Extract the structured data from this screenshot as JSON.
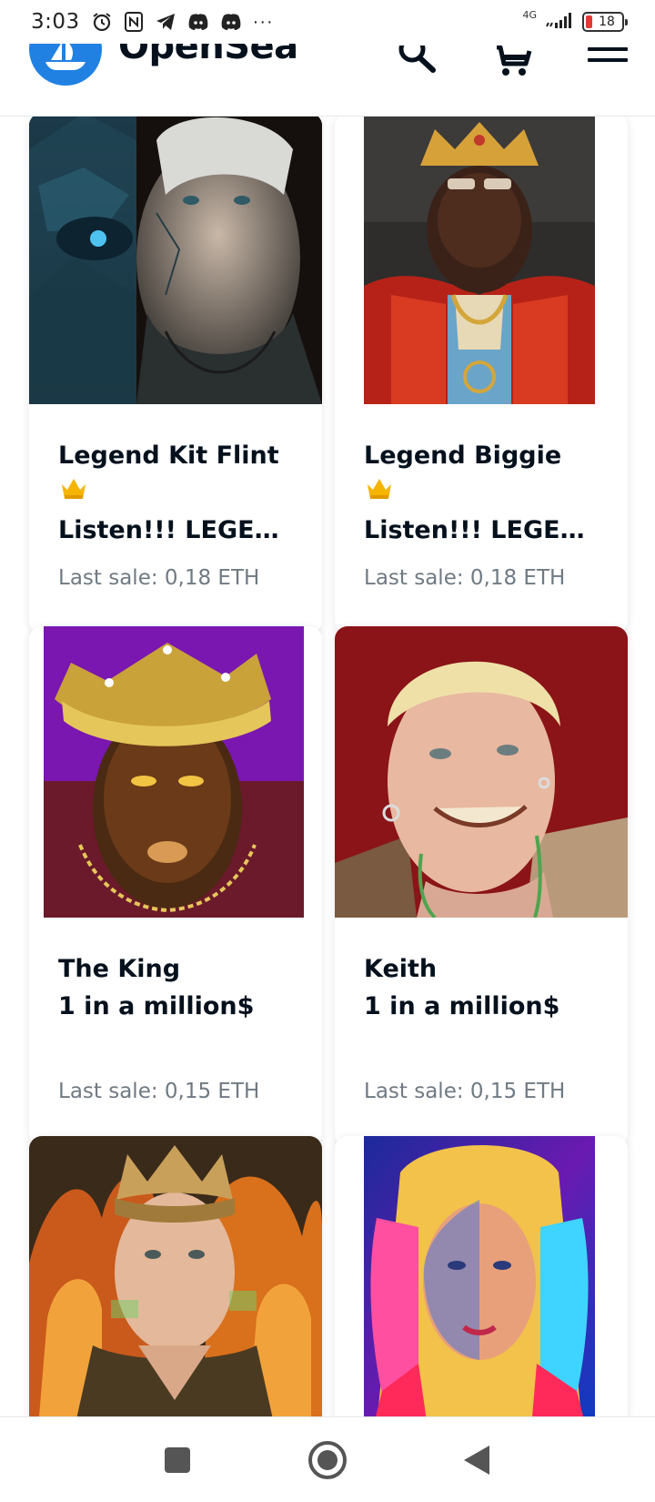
{
  "status_bar": {
    "time": "3:03",
    "network": "4G",
    "battery": "18",
    "more": "···",
    "icons": [
      "alarm-icon",
      "nfc-icon",
      "telegram-icon",
      "discord-icon",
      "discord-icon",
      "signal-icon",
      "battery-icon"
    ]
  },
  "header": {
    "logo_text": "OpenSea",
    "icons": [
      "opensea-logo-icon",
      "search-icon",
      "cart-icon",
      "menu-icon"
    ]
  },
  "cards": [
    {
      "title_line1": "Legend Kit Flint",
      "title_line2": "Listen!!! LEGE…",
      "title_emoji": "crown-icon",
      "sale_label": "Last sale:",
      "sale_price": "0,18 ETH"
    },
    {
      "title_line1": "Legend Biggie",
      "title_line2": "Listen!!! LEGE…",
      "title_emoji": "crown-icon",
      "sale_label": "Last sale:",
      "sale_price": "0,18 ETH"
    },
    {
      "title_line1": "The King",
      "title_line2": "1 in a million$",
      "sale_label": "Last sale:",
      "sale_price": "0,15 ETH"
    },
    {
      "title_line1": "Keith",
      "title_line2": "1 in a million$",
      "sale_label": "Last sale:",
      "sale_price": "0,15 ETH"
    },
    {
      "title_line1": "",
      "title_line2": "",
      "sale_label": "",
      "sale_price": ""
    },
    {
      "title_line1": "",
      "title_line2": "",
      "sale_label": "",
      "sale_price": ""
    }
  ],
  "nav_bar": {
    "icons": [
      "recents-square-icon",
      "home-circle-icon",
      "back-triangle-icon"
    ]
  },
  "colors": {
    "brand": "#2081e2",
    "text": "#04111d",
    "muted": "#707a83"
  }
}
